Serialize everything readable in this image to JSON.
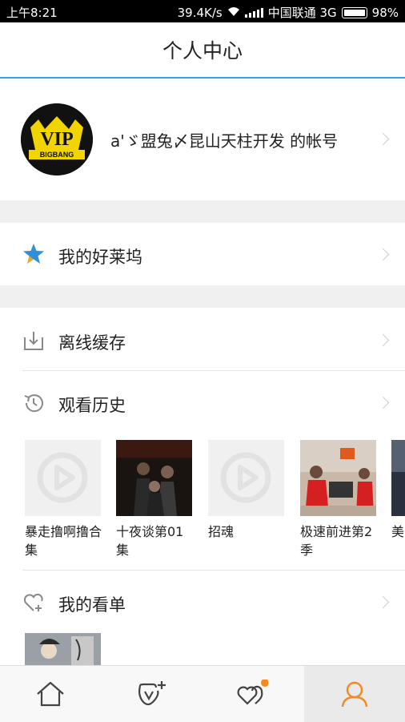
{
  "status": {
    "time": "上午8:21",
    "speed": "39.4K/s",
    "carrier": "中国联通 3G",
    "battery": "98%"
  },
  "header": {
    "title": "个人中心"
  },
  "profile": {
    "name": "a'ゞ盟兔〆昆山天柱开发 的帐号",
    "avatar_label": "BIGBANG"
  },
  "menu": {
    "hollywood": "我的好莱坞",
    "offline": "离线缓存",
    "history": "观看历史",
    "watchlist": "我的看单"
  },
  "history_items": [
    {
      "title": "暴走撸啊撸合集"
    },
    {
      "title": "十夜谈第01集"
    },
    {
      "title": "招魂"
    },
    {
      "title": "极速前进第2季"
    },
    {
      "title": "美"
    }
  ],
  "tabs": [
    {
      "name": "home-icon"
    },
    {
      "name": "subscribe-icon"
    },
    {
      "name": "hearts-icon"
    },
    {
      "name": "user-icon"
    }
  ],
  "colors": {
    "accent": "#2aa8e8",
    "active": "#f5891f",
    "badge": "#f5891f"
  }
}
